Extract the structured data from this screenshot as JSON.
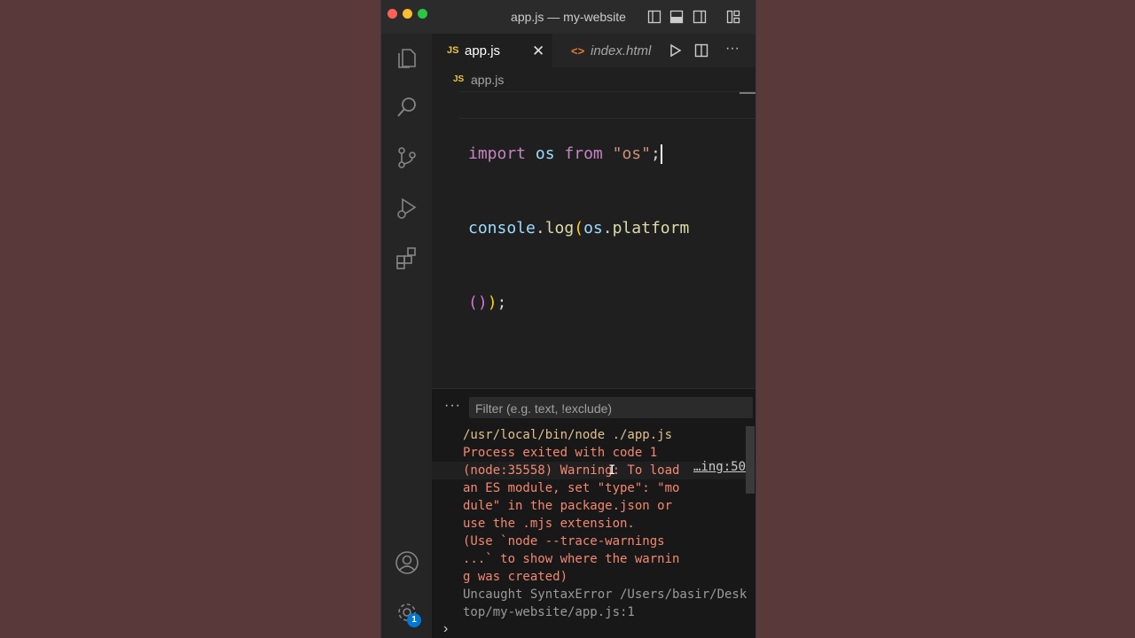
{
  "window": {
    "title": "app.js — my-website"
  },
  "tabs": [
    {
      "icon": "JS",
      "label": "app.js",
      "active": true
    },
    {
      "icon": "<>",
      "label": "index.html",
      "active": false
    }
  ],
  "breadcrumb": {
    "icon": "JS",
    "file": "app.js"
  },
  "editor": {
    "line1": {
      "import": "import",
      "ident": "os",
      "from": "from",
      "string": "\"os\"",
      "semi": ";"
    },
    "line2": {
      "console": "console",
      "dot1": ".",
      "log": "log",
      "paren_open": "(",
      "os": "os",
      "dot2": ".",
      "platform": "platform"
    },
    "line3": {
      "paren_inner": "()",
      "paren_close": ")",
      "semi": ";"
    }
  },
  "panel": {
    "more": "···",
    "filter_placeholder": "Filter (e.g. text, !exclude)",
    "lines": [
      "/usr/local/bin/node ./app.js",
      "Process exited with code 1",
      "(node:35558) Warning: To load",
      "an ES module, set \"type\": \"mo",
      "dule\" in the package.json or",
      "use the .mjs extension.",
      "(Use `node --trace-warnings",
      "...` to show where the warnin",
      "g was created)",
      "Uncaught SyntaxError /Users/basir/Desk",
      "top/my-website/app.js:1"
    ],
    "warning_source": "…ing:50",
    "prompt": "›"
  },
  "activity": {
    "icons": [
      "files-icon",
      "search-icon",
      "source-control-icon",
      "run-debug-icon",
      "extensions-icon",
      "account-icon",
      "settings-gear-icon"
    ],
    "settings_badge": "1"
  }
}
